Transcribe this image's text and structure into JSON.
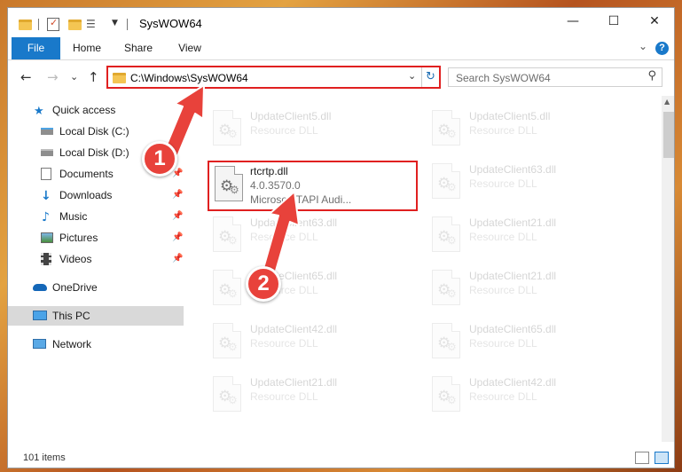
{
  "window": {
    "title": "SysWOW64",
    "minimize_glyph": "—",
    "maximize_glyph": "☐",
    "close_glyph": "✕"
  },
  "ribbon": {
    "tabs": [
      "File",
      "Home",
      "Share",
      "View"
    ],
    "help_label": "?",
    "expand_glyph": "⌄"
  },
  "nav": {
    "back_glyph": "←",
    "forward_glyph": "→",
    "recent_glyph": "⌄",
    "up_glyph": "↑",
    "address": "C:\\Windows\\SysWOW64",
    "address_dropdown_glyph": "⌄",
    "refresh_glyph": "↻",
    "search_placeholder": "Search SysWOW64",
    "search_glyph": "⚲"
  },
  "sidebar": {
    "items": [
      {
        "label": "Quick access",
        "icon": "star-icon",
        "pinned": false
      },
      {
        "label": "Local Disk (C:)",
        "icon": "drive-icon",
        "pinned": false
      },
      {
        "label": "Local Disk (D:)",
        "icon": "drive-icon",
        "pinned": false
      },
      {
        "label": "Documents",
        "icon": "documents-icon",
        "pinned": true
      },
      {
        "label": "Downloads",
        "icon": "download-icon",
        "pinned": true
      },
      {
        "label": "Music",
        "icon": "music-icon",
        "pinned": true
      },
      {
        "label": "Pictures",
        "icon": "pictures-icon",
        "pinned": true
      },
      {
        "label": "Videos",
        "icon": "videos-icon",
        "pinned": true
      },
      {
        "label": "OneDrive",
        "icon": "cloud-icon",
        "pinned": false
      },
      {
        "label": "This PC",
        "icon": "computer-icon",
        "pinned": false
      },
      {
        "label": "Network",
        "icon": "network-icon",
        "pinned": false
      }
    ],
    "pin_glyph": "📌",
    "selected": "This PC"
  },
  "files": {
    "highlighted": {
      "name": "rtcrtp.dll",
      "version": "4.0.3570.0",
      "description": "Microsoft TAPI Audi..."
    },
    "faded": [
      {
        "name": "UpdateClient5.dll",
        "type": "Resource DLL"
      },
      {
        "name": "UpdateClient5.dll",
        "type": "Resource DLL"
      },
      {
        "name": "UpdateClient63.dll",
        "type": "Resource DLL"
      },
      {
        "name": "UpdateClient63.dll",
        "type": "Resource DLL"
      },
      {
        "name": "UpdateClient21.dll",
        "type": "Resource DLL"
      },
      {
        "name": "UpdateClient65.dll",
        "type": "Resource DLL"
      },
      {
        "name": "UpdateClient21.dll",
        "type": "Resource DLL"
      },
      {
        "name": "UpdateClient42.dll",
        "type": "Resource DLL"
      },
      {
        "name": "UpdateClient65.dll",
        "type": "Resource DLL"
      },
      {
        "name": "UpdateClient21.dll",
        "type": "Resource DLL"
      },
      {
        "name": "UpdateClient42.dll",
        "type": "Resource DLL"
      }
    ]
  },
  "status": {
    "item_count": "101 items"
  },
  "annotations": {
    "step1": "1",
    "step2": "2",
    "color": "#e8423b"
  },
  "colors": {
    "accent": "#1979ca",
    "highlight_border": "#e02020",
    "selected_bg": "#d9d9d9"
  }
}
